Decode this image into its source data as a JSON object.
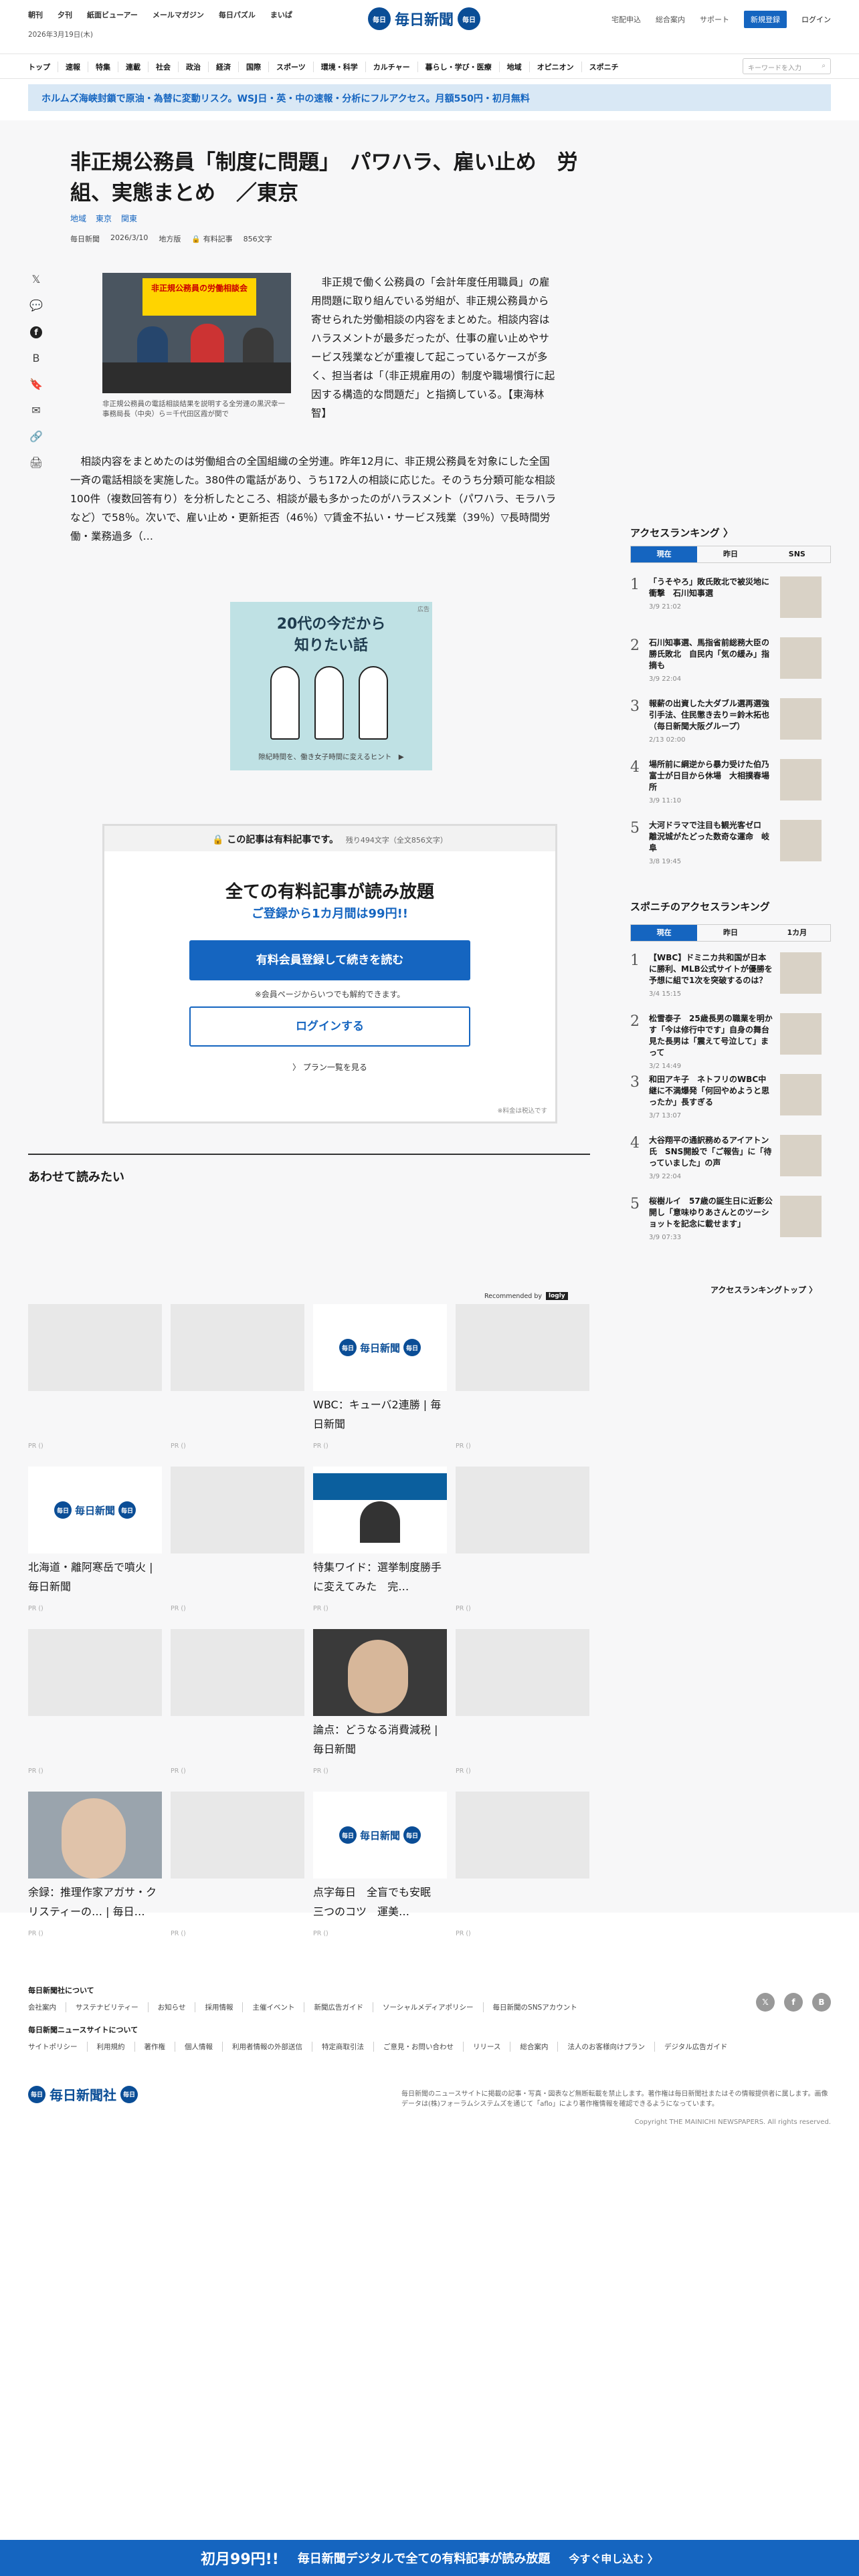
{
  "header": {
    "top_links": [
      "朝刊",
      "夕刊",
      "紙面ビューアー",
      "メールマガジン",
      "毎日パズル",
      "まいぱ"
    ],
    "date": "2026年3月19日(木)",
    "logo_text": "毎日新聞",
    "seal_text": "毎日",
    "right_links": [
      "宅配申込",
      "総合案内",
      "サポート"
    ],
    "register_label": "新規登録",
    "login_label": "ログイン"
  },
  "nav": {
    "items": [
      "トップ",
      "速報",
      "特集",
      "連載",
      "社会",
      "政治",
      "経済",
      "国際",
      "スポーツ",
      "環境・科学",
      "カルチャー",
      "暮らし・学び・医療",
      "地域",
      "オピニオン",
      "スポニチ"
    ],
    "search_placeholder": "キーワードを入力",
    "search_icon": "⌕"
  },
  "promo": {
    "text": "ホルムズ海峡封鎖で原油・為替に変動リスク。WSJ日・英・中の速報・分析にフルアクセス。月額550円・初月無料"
  },
  "article": {
    "title": "非正規公務員「制度に問題」　パワハラ、雇い止め　労組、実態まとめ　／東京",
    "tags": [
      "地域",
      "東京",
      "関東"
    ],
    "meta": [
      "毎日新聞",
      "2026/3/10",
      "地方版",
      "有料記事",
      "856文字"
    ],
    "paid_icon": "🔒",
    "share_icons": [
      "𝕏",
      "💬",
      "f",
      "B",
      "🔖",
      "✉",
      "🔗",
      "🖨"
    ],
    "photo_banner": "非正規公務員の労働相談会",
    "caption": "非正規公務員の電話相談結果を説明する全労連の黒沢幸一事務局長（中央）ら＝千代田区霞が関で",
    "lead": "　非正規で働く公務員の「会計年度任用職員」の雇用問題に取り組んでいる労組が、非正規公務員から寄せられた労働相談の内容をまとめた。相談内容はハラスメントが最多だったが、仕事の雇い止めやサービス残業などが重複して起こっているケースが多く、担当者は「（非正規雇用の）制度や職場慣行に起因する構造的な問題だ」と指摘している。【東海林智】",
    "body": "　相談内容をまとめたのは労働組合の全国組織の全労連。昨年12月に、非正規公務員を対象にした全国一斉の電話相談を実施した。380件の電話があり、うち172人の相談に応じた。そのうち分類可能な相談100件（複数回答有り）を分析したところ、相談が最も多かったのがハラスメント（パワハラ、モラハラなど）で58％。次いで、雇い止め・更新拒否（46％）▽賃金不払い・サービス残業（39％）▽長時間労働・業務過多（…"
  },
  "ad": {
    "title": "20代の今だから\n知りたい話",
    "caption": "隙紀時間を、働き女子時間に変えるヒント　▶",
    "tag": "広告"
  },
  "paywall": {
    "notice": "この記事は有料記事です。",
    "remaining": "残り494文字（全文856文字）",
    "headline": "全ての有料記事が読み放題",
    "sub": "ご登録から1カ月間は99円!!",
    "cta": "有料会員登録して続きを読む",
    "note": "※会員ページからいつでも解約できます。",
    "login": "ログインする",
    "plans": "〉 プラン一覧を見る",
    "tax": "※料金は税込です"
  },
  "related": {
    "title": "あわせて読みたい",
    "recommended_by": "Recommended by",
    "rec_logo": "logly",
    "pr_label": "PR ()",
    "cards": [
      {
        "type": "blank",
        "text": ""
      },
      {
        "type": "blank",
        "text": ""
      },
      {
        "type": "logo",
        "text": "WBC：キューバ2連勝 | 毎日新聞"
      },
      {
        "type": "blank",
        "text": ""
      },
      {
        "type": "logo",
        "text": "北海道・離阿寒岳で噴火 | 毎日新聞"
      },
      {
        "type": "blank",
        "text": ""
      },
      {
        "type": "press",
        "text": "特集ワイド：選挙制度勝手に変えてみた　完…"
      },
      {
        "type": "blank",
        "text": ""
      },
      {
        "type": "blank",
        "text": ""
      },
      {
        "type": "blank",
        "text": ""
      },
      {
        "type": "face",
        "text": "論点：どうなる消費減税 | 毎日新聞"
      },
      {
        "type": "blank",
        "text": ""
      },
      {
        "type": "face2",
        "text": "余録：推理作家アガサ・クリスティーの… | 毎日…"
      },
      {
        "type": "blank",
        "text": ""
      },
      {
        "type": "logo",
        "text": "点字毎日　全盲でも安眠　三つのコツ　運美…"
      },
      {
        "type": "blank",
        "text": ""
      }
    ]
  },
  "sidebar": {
    "ranking_title": "アクセスランキング 〉",
    "tabs": [
      "現在",
      "昨日",
      "SNS"
    ],
    "items": [
      {
        "n": "1",
        "text": "「うそやろ」敗氏敗北で被災地に衝撃　石川知事選",
        "time": "3/9 21:02"
      },
      {
        "n": "2",
        "text": "石川知事選、馬指省前総務大臣の勝氏敗北　自民内「気の緩み」指摘も",
        "time": "3/9 22:04"
      },
      {
        "n": "3",
        "text": "報薪の出資した大ダブル選再選強引手法、住民懲き去り＝鈴木拓也（毎日新聞大阪グループ）",
        "time": "2/13 02:00"
      },
      {
        "n": "4",
        "text": "場所前に綱逆から暴力受けた伯乃富士が日目から休場　大相撲春場所",
        "time": "3/9 11:10"
      },
      {
        "n": "5",
        "text": "大河ドラマで注目も観光客ゼロ　離況城がたどった数奇な運命　岐阜",
        "time": "3/8 19:45"
      }
    ],
    "spo_title": "スポニチのアクセスランキング",
    "spo_tabs": [
      "現在",
      "昨日",
      "1カ月"
    ],
    "spo_items": [
      {
        "n": "1",
        "text": "【WBC】ドミニカ共和国が日本に勝利、MLB公式サイトが優勝を予想に組で1次を突破するのは？",
        "time": "3/4 15:15"
      },
      {
        "n": "2",
        "text": "松雪泰子　25歳長男の職業を明かす「今は修行中です」自身の舞台見た長男は「震えて号泣して」まって",
        "time": "3/2 14:49"
      },
      {
        "n": "3",
        "text": "和田アキ子　ネトフリのWBC中継に不満爆発「何回やめようと思ったか」長すぎる",
        "time": "3/7 13:07"
      },
      {
        "n": "4",
        "text": "大谷翔平の通訳務めるアイアトン氏　SNS開設で「ご報告」に「待っていました」の声",
        "time": "3/9 22:04"
      },
      {
        "n": "5",
        "text": "桜樹ルイ　57歳の誕生日に近影公開し「意味ゆりあさんとのツーショットを記念に載せます」",
        "time": "3/9 07:33"
      }
    ],
    "more_label": "アクセスランキングトップ 〉"
  },
  "footer": {
    "about_title": "毎日新聞社について",
    "about_links": [
      "会社案内",
      "サステナビリティー",
      "お知らせ",
      "採用情報",
      "主催イベント",
      "新聞広告ガイド",
      "ソーシャルメディアポリシー",
      "毎日新聞のSNSアカウント"
    ],
    "site_title": "毎日新聞ニュースサイトについて",
    "site_links": [
      "サイトポリシー",
      "利用規約",
      "著作権",
      "個人情報",
      "利用者情報の外部送信",
      "特定商取引法",
      "ご意見・お問い合わせ",
      "リリース",
      "総合案内",
      "法人のお客様向けプラン",
      "デジタル広告ガイド"
    ],
    "social": [
      "𝕏",
      "f",
      "B"
    ],
    "logo_text": "毎日新聞社",
    "note": "毎日新聞のニュースサイトに掲載の記事・写真・図表など無断転載を禁止します。著作権は毎日新聞社またはその情報提供者に属します。画像データは(株)フォーラムシステムズを通じて「aflo」により著作権情報を確認できるようになっています。",
    "copyright": "Copyright THE MAINICHI NEWSPAPERS. All rights reserved."
  },
  "bottom_bar": {
    "a": "初月99円!!",
    "b": "毎日新聞デジタルで全ての有料記事が読み放題",
    "c": "今すぐ申し込む 〉"
  }
}
